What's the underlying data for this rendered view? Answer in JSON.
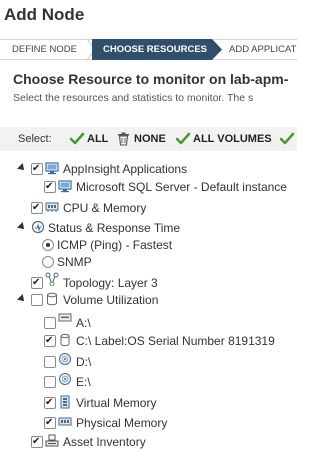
{
  "page": {
    "title": "Add Node"
  },
  "wizard": {
    "steps": [
      {
        "label": "DEFINE NODE",
        "active": false
      },
      {
        "label": "CHOOSE RESOURCES",
        "active": true
      },
      {
        "label": "ADD APPLICAT",
        "active": false
      }
    ]
  },
  "main": {
    "heading": "Choose Resource to monitor on lab-apm-",
    "subtext": "Select the resources and statistics to monitor. The s"
  },
  "selectbar": {
    "label": "Select:",
    "all": "ALL",
    "none": "NONE",
    "all_volumes": "ALL VOLUMES"
  },
  "tree": {
    "appinsight": {
      "label": "AppInsight Applications",
      "checked": true,
      "icon": "application-icon"
    },
    "sqlserver": {
      "label": "Microsoft SQL Server - Default instance",
      "checked": true,
      "icon": "application-icon"
    },
    "cpu": {
      "label": "CPU & Memory",
      "checked": true,
      "icon": "memory-chip-icon"
    },
    "status": {
      "label": "Status & Response Time",
      "icon": "status-icon"
    },
    "icmp": {
      "label": "ICMP (Ping) - Fastest",
      "selected": true
    },
    "snmp": {
      "label": "SNMP",
      "selected": false
    },
    "topology": {
      "label": "Topology: Layer 3",
      "checked": true,
      "icon": "topology-icon"
    },
    "volumes": {
      "label": "Volume Utilization",
      "checked": false,
      "icon": "volume-icon"
    },
    "vol_a": {
      "label": "A:\\",
      "checked": false,
      "icon": "floppy-drive-icon"
    },
    "vol_c": {
      "label": "C:\\ Label:OS Serial Number 8191319",
      "checked": true,
      "icon": "hard-drive-icon"
    },
    "vol_d": {
      "label": "D:\\",
      "checked": false,
      "icon": "cd-drive-icon"
    },
    "vol_e": {
      "label": "E:\\",
      "checked": false,
      "icon": "cd-drive-icon"
    },
    "virtual_mem": {
      "label": "Virtual Memory",
      "checked": true,
      "icon": "virtual-memory-icon"
    },
    "physical_mem": {
      "label": "Physical Memory",
      "checked": true,
      "icon": "physical-memory-icon"
    },
    "asset": {
      "label": "Asset Inventory",
      "checked": true,
      "icon": "asset-inventory-icon"
    }
  },
  "colors": {
    "wizard_active": "#2f4f6b",
    "check_green": "#4a9b2e",
    "selectbar_bg": "#f2f2f2"
  }
}
